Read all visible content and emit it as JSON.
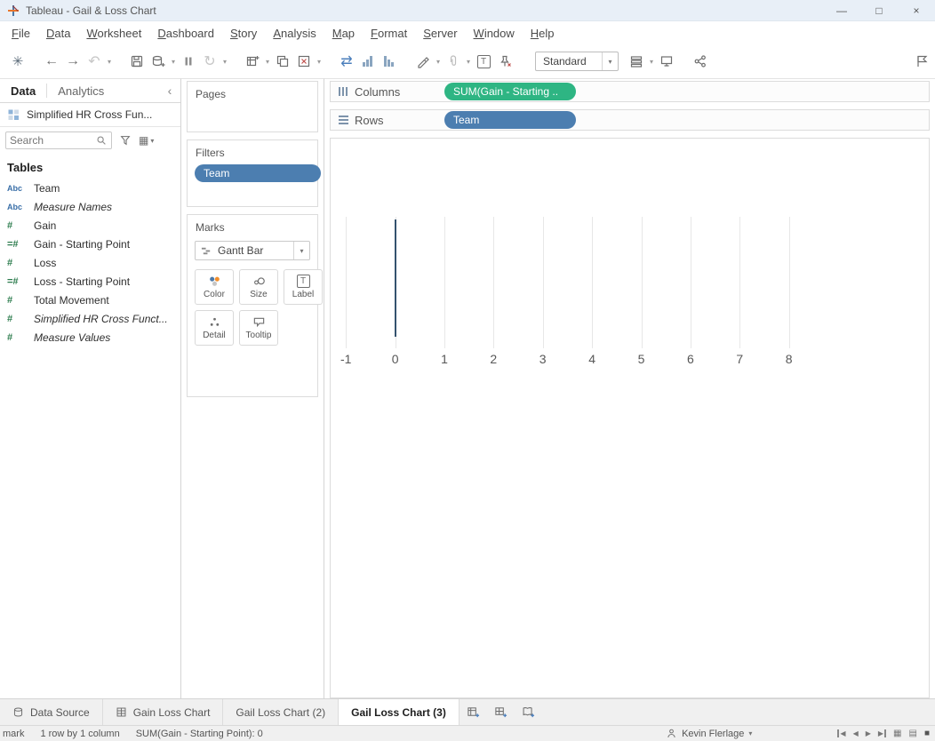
{
  "colors": {
    "titlebar_bg": "#e8eff7",
    "chrome_bg": "#f0f0f0",
    "dimension_pill_blue": "#4c7eb0",
    "measure_pill_green": "#2eb583",
    "dimension_icon_blue": "#3a6fa8",
    "measure_icon_green": "#2e7d4f",
    "gantt_mark_color": "#34526e"
  },
  "icons": {
    "logo": "✳",
    "back": "←",
    "forward": "→",
    "undo": "↶",
    "caret": "▾",
    "refresh": "↻",
    "swap_axes": "⇄",
    "label_T": "T",
    "collapse": "‹",
    "grid_view": "▦",
    "nav_prev": "◀",
    "nav_next": "▶",
    "sheet_sorter": "▦",
    "filmstrip": "▤",
    "show_tabs": "■"
  },
  "titlebar": {
    "title": "Tableau - Gail & Loss Chart",
    "minimize_glyph": "—",
    "maximize_glyph": "□",
    "close_glyph": "×"
  },
  "menubar": {
    "items": [
      "File",
      "Data",
      "Worksheet",
      "Dashboard",
      "Story",
      "Analysis",
      "Map",
      "Format",
      "Server",
      "Window",
      "Help"
    ]
  },
  "toolbar": {
    "fit_dropdown_value": "Standard"
  },
  "data_pane": {
    "tab_data": "Data",
    "tab_analytics": "Analytics",
    "datasource_name": "Simplified HR Cross Fun...",
    "search_placeholder": "Search",
    "tables_header": "Tables",
    "fields": [
      {
        "icon": "Abc",
        "label": "Team",
        "italic": false,
        "role": "dimension"
      },
      {
        "icon": "Abc",
        "label": "Measure Names",
        "italic": true,
        "role": "dimension"
      },
      {
        "icon": "#",
        "label": "Gain",
        "italic": false,
        "role": "measure"
      },
      {
        "icon": "=#",
        "label": "Gain - Starting Point",
        "italic": false,
        "role": "calculated-measure"
      },
      {
        "icon": "#",
        "label": "Loss",
        "italic": false,
        "role": "measure"
      },
      {
        "icon": "=#",
        "label": "Loss - Starting Point",
        "italic": false,
        "role": "calculated-measure"
      },
      {
        "icon": "#",
        "label": "Total Movement",
        "italic": false,
        "role": "measure"
      },
      {
        "icon": "#",
        "label": "Simplified HR Cross Funct...",
        "italic": true,
        "role": "measure"
      },
      {
        "icon": "#",
        "label": "Measure Values",
        "italic": true,
        "role": "measure"
      }
    ]
  },
  "cards": {
    "pages_title": "Pages",
    "filters_title": "Filters",
    "filter_pill": "Team",
    "marks_title": "Marks",
    "mark_type": "Gantt Bar",
    "buttons": {
      "color": "Color",
      "size": "Size",
      "label": "Label",
      "detail": "Detail",
      "tooltip": "Tooltip"
    }
  },
  "shelves": {
    "columns_label": "Columns",
    "columns_pill": "SUM(Gain - Starting ..",
    "rows_label": "Rows",
    "rows_pill": "Team"
  },
  "chart_data": {
    "type": "gantt",
    "x_field": "SUM(Gain - Starting Point)",
    "row_field": "Team",
    "x_ticks": [
      -1,
      0,
      1,
      2,
      3,
      4,
      5,
      6,
      7,
      8
    ],
    "xlim": [
      -1.31,
      8.15
    ],
    "rows": [
      "(single team row)"
    ],
    "marks": [
      {
        "x": 0
      }
    ],
    "grid": true,
    "legend": "none"
  },
  "sheet_tabs": {
    "data_source": "Data Source",
    "tabs": [
      {
        "label": "Gain Loss Chart",
        "active": false
      },
      {
        "label": "Gail Loss Chart (2)",
        "active": false
      },
      {
        "label": "Gail Loss Chart (3)",
        "active": true
      }
    ]
  },
  "status_bar": {
    "marks_count": "mark",
    "dimensions": "1 row by 1 column",
    "aggregate": "SUM(Gain - Starting Point): 0",
    "user": "Kevin Flerlage"
  }
}
